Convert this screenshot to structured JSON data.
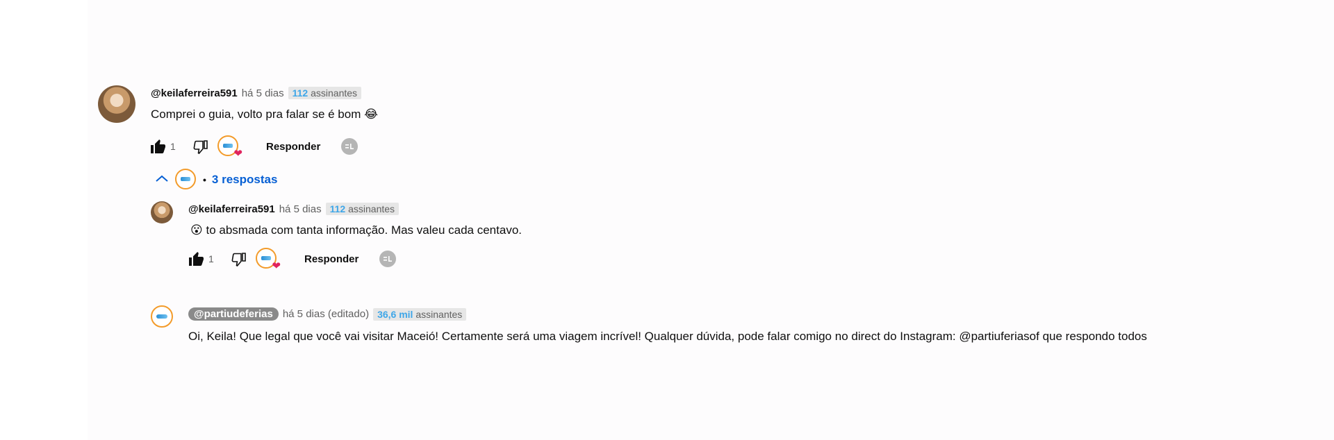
{
  "comment": {
    "author": "@keilaferreira591",
    "time": "há 5 dias",
    "subs_count": "112",
    "subs_label": "assinantes",
    "text": "Comprei  o guia, volto pra falar se é bom",
    "emoji": "😂",
    "likes": "1",
    "reply_label": "Responder"
  },
  "replies_toggle": {
    "label": "3 respostas",
    "bullet": "•"
  },
  "reply1": {
    "author": "@keilaferreira591",
    "time": "há 5 dias",
    "subs_count": "112",
    "subs_label": "assinantes",
    "emoji": "😮",
    "text": "to absmada com tanta informação. Mas valeu cada centavo.",
    "likes": "1",
    "reply_label": "Responder"
  },
  "reply2": {
    "author": "@partiudeferias",
    "time": "há 5 dias (editado)",
    "subs_count": "36,6 mil",
    "subs_label": "assinantes",
    "text": "Oi, Keila! Que legal que você vai visitar Maceió! Certamente será uma viagem incrível! Qualquer dúvida, pode falar comigo no direct do Instagram: @partiuferiasof que respondo todos"
  },
  "icons": {
    "like": "thumb-up-icon",
    "dislike": "thumb-down-icon",
    "heart": "heart-icon",
    "chevron": "chevron-up-icon",
    "badge": "eq-badge-icon"
  },
  "colors": {
    "link_blue": "#065fd4",
    "subs_blue": "#3ea6e8",
    "heart_red": "#e0245e",
    "brand_orange": "#f39b2a"
  }
}
